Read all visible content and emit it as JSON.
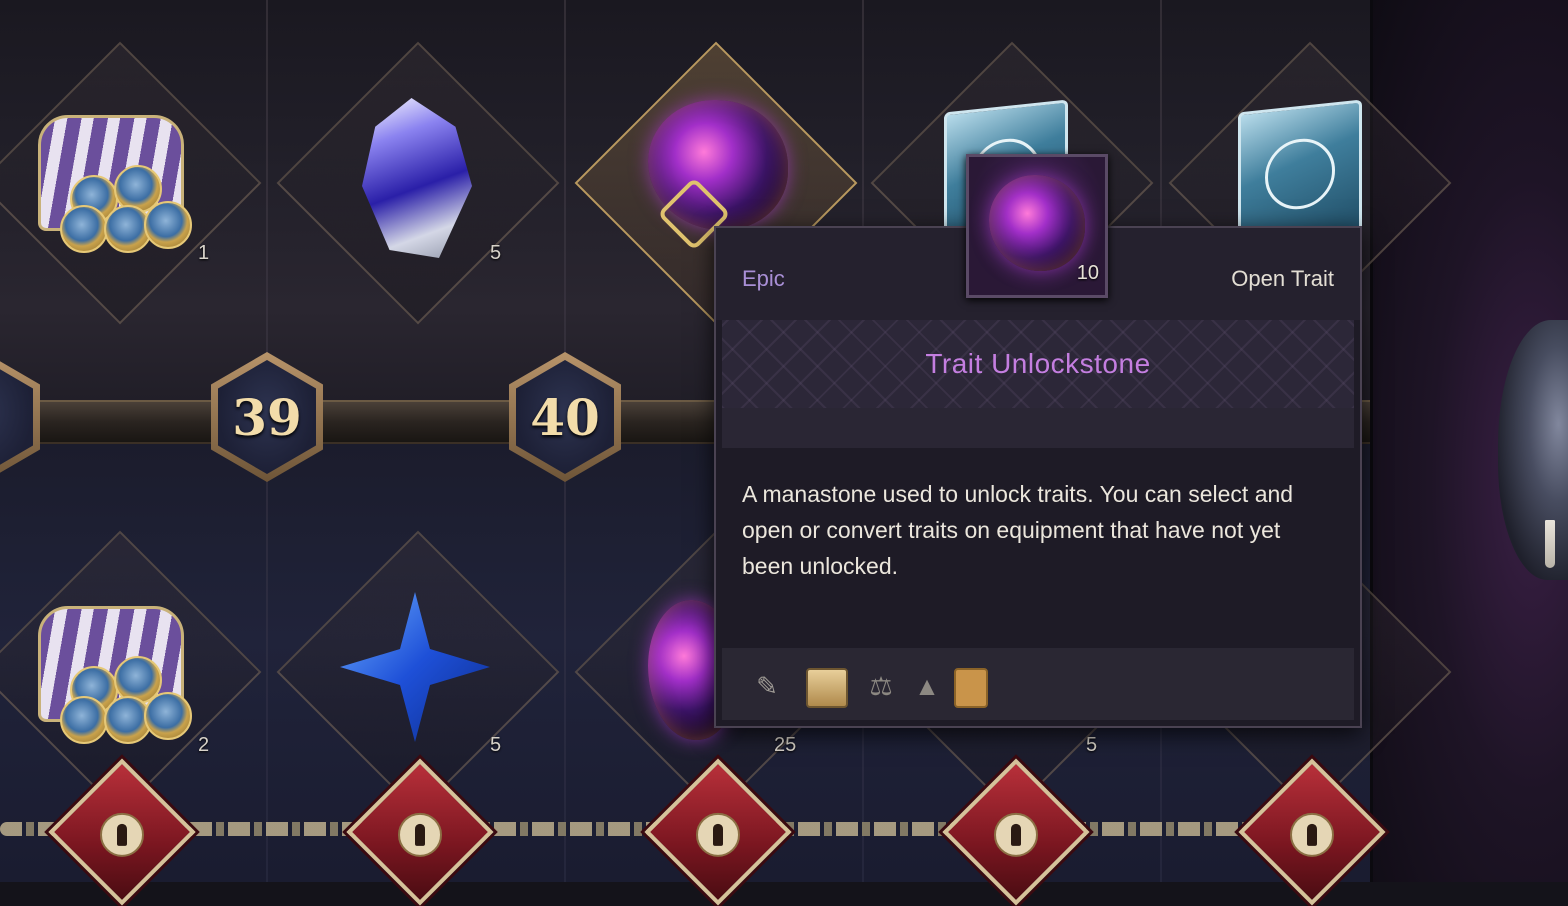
{
  "levels": [
    "39",
    "40"
  ],
  "top_row": {
    "counts": [
      "1",
      "5"
    ]
  },
  "bottom_row": {
    "counts": [
      "2",
      "5",
      "25",
      "5"
    ]
  },
  "tooltip": {
    "rarity": "Epic",
    "action": "Open Trait",
    "item_count": "10",
    "item_name": "Trait Unlockstone",
    "description": "A manastone used to unlock traits. You can select and open or convert traits on equipment that have not yet been unlocked.",
    "footer_icons": [
      "book-quill-icon",
      "crate-icon",
      "scales-icon",
      "flask-icon",
      "trash-icon"
    ]
  },
  "colors": {
    "rarity_epic": "#a98fd6",
    "item_name": "#c47ee0",
    "level_text": "#f2dcaa",
    "lock_red": "#b8303a"
  }
}
